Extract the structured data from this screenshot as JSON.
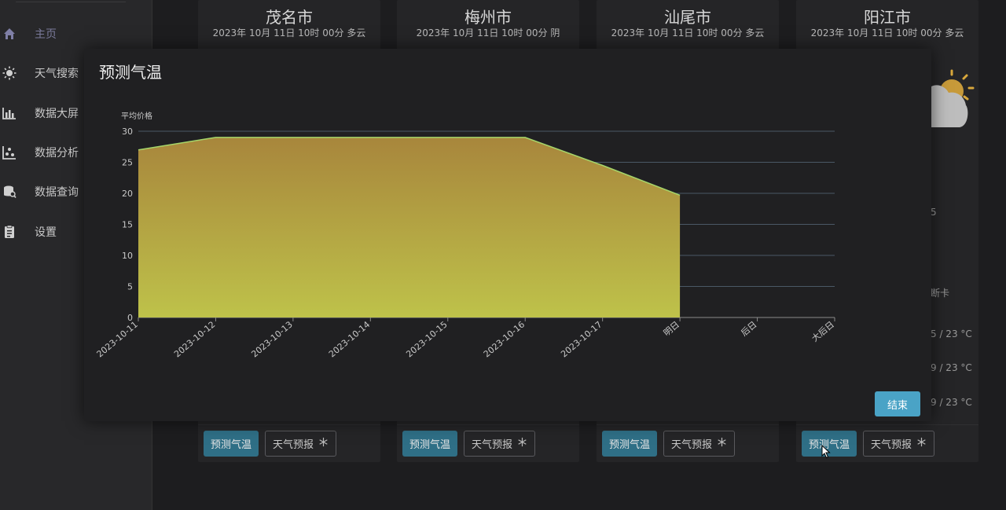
{
  "sidebar": {
    "items": [
      {
        "label": "主页",
        "icon": "home-icon"
      },
      {
        "label": "天气搜索",
        "icon": "sun-icon"
      },
      {
        "label": "数据大屏",
        "icon": "bar-chart-icon"
      },
      {
        "label": "数据分析",
        "icon": "scatter-chart-icon"
      },
      {
        "label": "数据查询",
        "icon": "database-search-icon"
      },
      {
        "label": "设置",
        "icon": "clipboard-icon"
      }
    ]
  },
  "cards": [
    {
      "city": "茂名市",
      "subtitle": "2023年 10月 11日 10时 00分 多云",
      "forecast_temp_label": "预测气温",
      "weather_forecast_label": "天气预报"
    },
    {
      "city": "梅州市",
      "subtitle": "2023年 10月 11日 10时 00分 阴",
      "forecast_temp_label": "预测气温",
      "weather_forecast_label": "天气预报"
    },
    {
      "city": "汕尾市",
      "subtitle": "2023年 10月 11日 10时 00分 多云",
      "forecast_temp_label": "预测气温",
      "weather_forecast_label": "天气预报"
    },
    {
      "city": "阳江市",
      "subtitle": "2023年 10月 11日 10时 00分 多云",
      "forecast_temp_label": "预测气温",
      "weather_forecast_label": "天气预报"
    }
  ],
  "right_partial": {
    "text_5": "5",
    "text_duanka": "断卡",
    "temp1": "5 / 23 °C",
    "temp2": "9 / 23 °C",
    "temp3": "9 / 23 °C"
  },
  "modal": {
    "title": "预测气温",
    "end_label": "结束"
  },
  "chart_data": {
    "type": "area",
    "ylabel": "平均价格",
    "ylim": [
      0,
      30
    ],
    "yticks": [
      0,
      5,
      10,
      15,
      20,
      25,
      30
    ],
    "categories": [
      "2023-10-11",
      "2023-10-12",
      "2023-10-13",
      "2023-10-14",
      "2023-10-15",
      "2023-10-16",
      "2023-10-17",
      "明日",
      "后日",
      "大后日"
    ],
    "values": [
      27,
      29,
      29,
      29,
      29,
      29,
      24.5,
      19.7,
      null,
      null
    ],
    "colors": {
      "fill_top": "#a8863c",
      "fill_bottom": "#bec24a",
      "line": "#a6d66a"
    }
  }
}
